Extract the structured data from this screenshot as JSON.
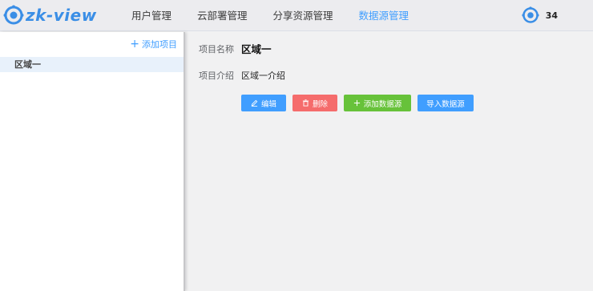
{
  "app": {
    "logo_text": "zk-view",
    "brand_color": "#409eff"
  },
  "nav": {
    "items": [
      {
        "label": "用户管理",
        "active": false
      },
      {
        "label": "云部署管理",
        "active": false
      },
      {
        "label": "分享资源管理",
        "active": false
      },
      {
        "label": "数据源管理",
        "active": true
      }
    ]
  },
  "user": {
    "icon": "target-circle-icon",
    "count": "34"
  },
  "sidebar": {
    "add_label": "添加项目",
    "items": [
      {
        "label": "区域一",
        "selected": true
      }
    ]
  },
  "detail": {
    "name_label": "项目名称",
    "name_value": "区域一",
    "desc_label": "项目介绍",
    "desc_value": "区域一介绍"
  },
  "actions": {
    "edit": "编辑",
    "delete": "删除",
    "add_datasource": "添加数据源",
    "import_datasource": "导入数据源",
    "colors": {
      "primary": "#409eff",
      "danger": "#f56c6c",
      "success": "#67c23a"
    }
  }
}
